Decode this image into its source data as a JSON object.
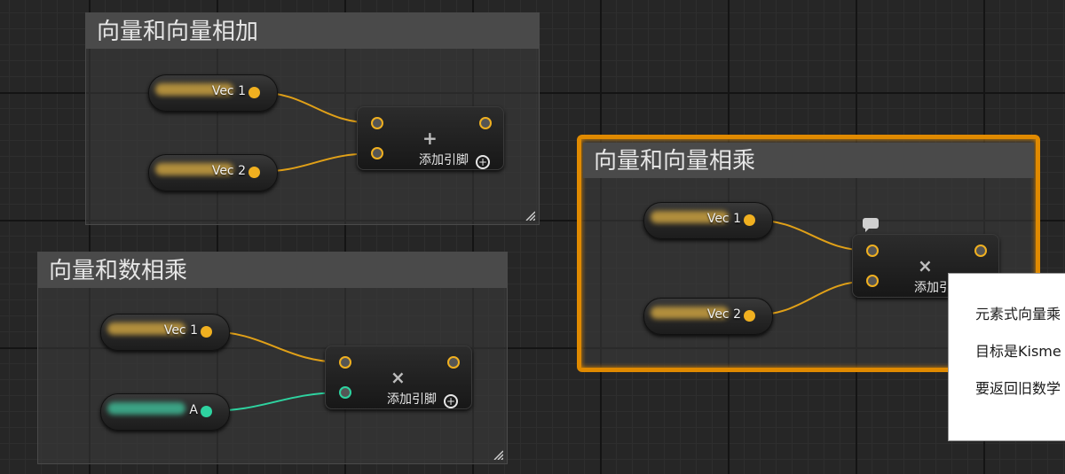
{
  "colors": {
    "vector_pin": "#f0b020",
    "float_pin": "#2ed3a0",
    "selection": "#e08a00"
  },
  "comments": [
    {
      "title": "向量和向量相加"
    },
    {
      "title": "向量和数相乘"
    },
    {
      "title": "向量和向量相乘"
    }
  ],
  "nodes": {
    "add_vec1": "Vec 1",
    "add_vec2": "Vec 2",
    "scale_vec1": "Vec 1",
    "scale_a": "A",
    "mul_vec1": "Vec 1",
    "mul_vec2": "Vec 2"
  },
  "operators": {
    "add": {
      "symbol": "+",
      "add_pin": "添加引脚"
    },
    "scale": {
      "symbol": "×",
      "add_pin": "添加引脚"
    },
    "multiply": {
      "symbol": "×",
      "add_pin": "添加引"
    }
  },
  "icons": {
    "comment_bubble": "speech-bubble-icon",
    "add_pin": "plus-circle-icon",
    "resize": "resize-grip-icon"
  },
  "tooltip": {
    "lines": [
      "元素式向量乘",
      "目标是Kisme",
      "要返回旧数学"
    ]
  }
}
